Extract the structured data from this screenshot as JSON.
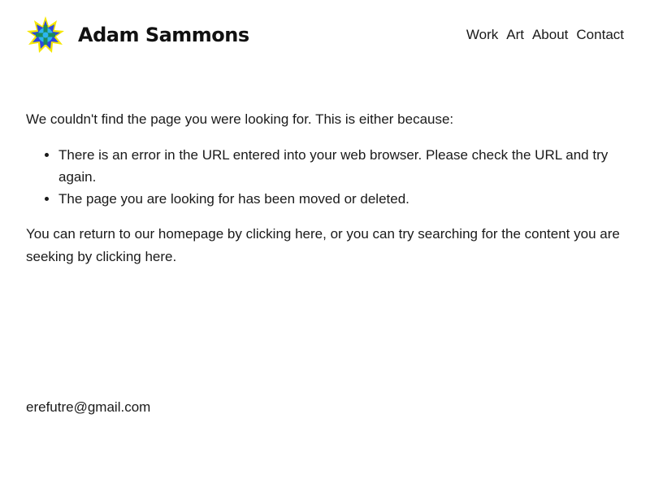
{
  "header": {
    "site_title": "Adam Sammons",
    "nav": [
      {
        "label": "Work"
      },
      {
        "label": "Art"
      },
      {
        "label": "About"
      },
      {
        "label": "Contact"
      }
    ]
  },
  "logo": {
    "icon": "star-burst-logo-icon",
    "colors": {
      "outer": "#f5e600",
      "middle": "#2e45e0",
      "inner": "#2bb5f0",
      "cross": "#1c8a5a"
    }
  },
  "main": {
    "intro": "We couldn't find the page you were looking for. This is either because:",
    "reasons": [
      "There is an error in the URL entered into your web browser. Please check the URL and try again.",
      "The page you are looking for has been moved or deleted."
    ],
    "return_text_1": "You can return to our homepage by ",
    "return_link_1": "clicking here",
    "return_text_2": ", or you can try searching for the content you are seeking by ",
    "return_link_2": "clicking here",
    "return_text_3": "."
  },
  "footer": {
    "email": "erefutre@gmail.com"
  }
}
